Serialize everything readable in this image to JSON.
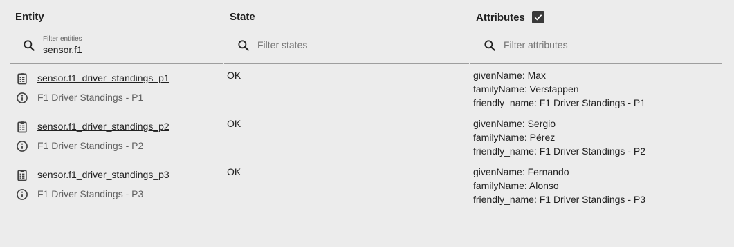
{
  "headers": {
    "entity": "Entity",
    "state": "State",
    "attributes": "Attributes",
    "attributes_checked": true
  },
  "filters": {
    "entity": {
      "label": "Filter entities",
      "value": "sensor.f1"
    },
    "state": {
      "placeholder": "Filter states",
      "value": ""
    },
    "attributes": {
      "placeholder": "Filter attributes",
      "value": ""
    }
  },
  "rows": [
    {
      "entity_id": "sensor.f1_driver_standings_p1",
      "friendly_name": "F1 Driver Standings - P1",
      "state": "OK",
      "attributes": [
        "givenName: Max",
        "familyName: Verstappen",
        "friendly_name: F1 Driver Standings - P1"
      ]
    },
    {
      "entity_id": "sensor.f1_driver_standings_p2",
      "friendly_name": "F1 Driver Standings - P2",
      "state": "OK",
      "attributes": [
        "givenName: Sergio",
        "familyName: Pérez",
        "friendly_name: F1 Driver Standings - P2"
      ]
    },
    {
      "entity_id": "sensor.f1_driver_standings_p3",
      "friendly_name": "F1 Driver Standings - P3",
      "state": "OK",
      "attributes": [
        "givenName: Fernando",
        "familyName: Alonso",
        "friendly_name: F1 Driver Standings - P3"
      ]
    }
  ],
  "icons": {
    "search": "search-icon",
    "entity": "clipboard-list-icon",
    "info": "info-circle-icon",
    "checkbox": "check-icon"
  },
  "colors": {
    "background": "#ececec",
    "text": "#212121",
    "muted": "#616161",
    "checkbox": "#3a3a3a"
  }
}
